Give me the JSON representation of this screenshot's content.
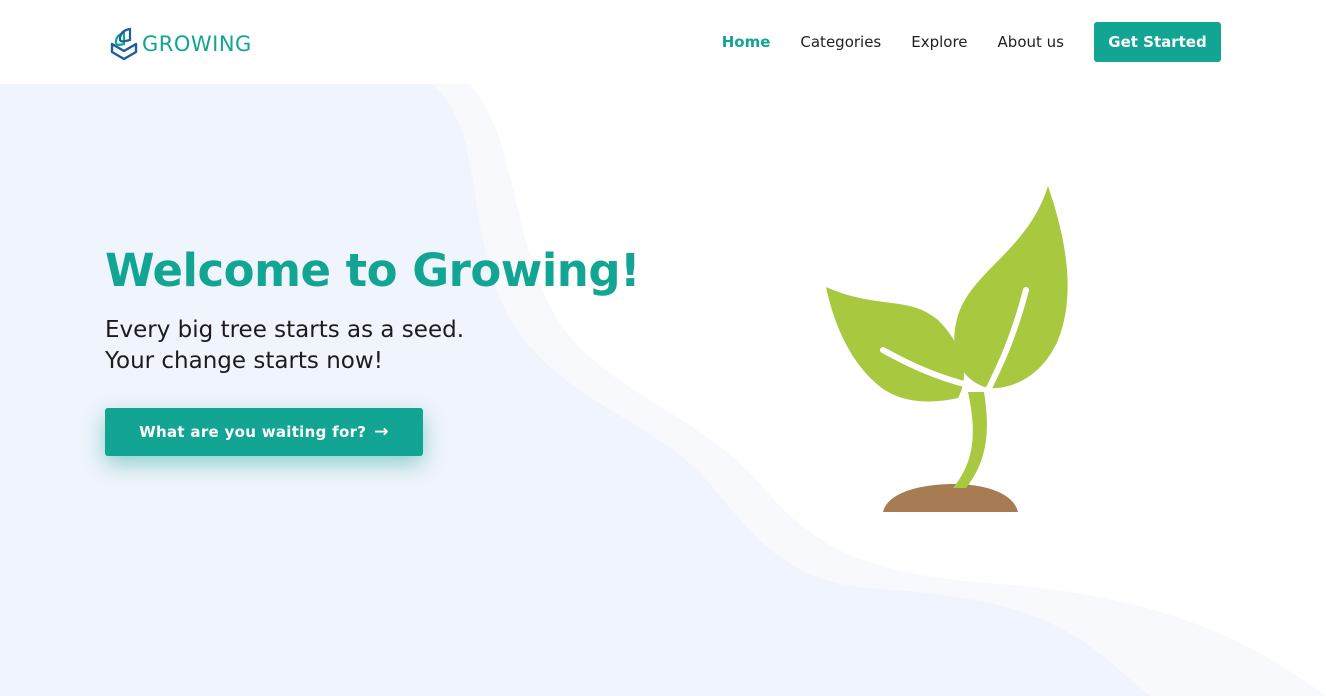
{
  "brand": {
    "name": "GROWING",
    "color": "#12a594",
    "logo_icon": "book-stack-icon"
  },
  "nav": {
    "items": [
      {
        "label": "Home",
        "active": true
      },
      {
        "label": "Categories",
        "active": false
      },
      {
        "label": "Explore",
        "active": false
      },
      {
        "label": "About us",
        "active": false
      }
    ],
    "cta_label": "Get Started"
  },
  "hero": {
    "title": "Welcome to Growing!",
    "subtitle_line1": "Every big tree starts as a seed.",
    "subtitle_line2": "Your change starts now!",
    "button_label": "What are you waiting for?",
    "button_icon": "arrow-right-icon",
    "illustration": "sprout-icon"
  },
  "colors": {
    "accent": "#12a594",
    "hero_bg": "#f0f4fc",
    "leaf": "#a8c83f",
    "soil": "#a77b54"
  }
}
